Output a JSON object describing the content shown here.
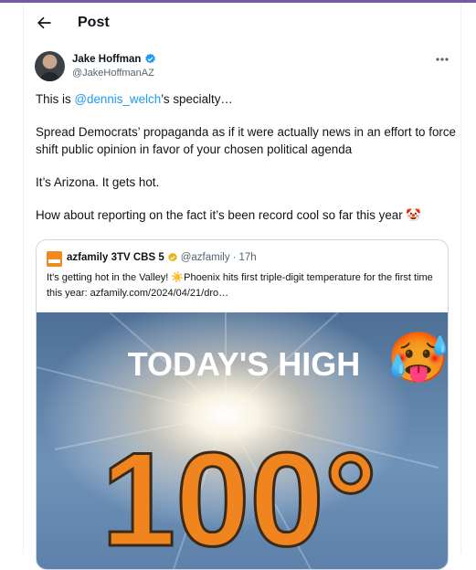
{
  "header": {
    "title": "Post",
    "back_icon": "back-arrow-icon"
  },
  "tweet": {
    "author_name": "Jake Hoffman",
    "author_handle": "@JakeHoffmanAZ",
    "verified_icon": "verified-badge-icon",
    "more_icon": "more-dots-icon",
    "line1_before": "This is ",
    "line1_mention": "@dennis_welch",
    "line1_after": "’s specialty…",
    "paragraph2": "Spread Democrats’ propaganda as if it were actually news in an effort to force shift public opinion in favor of your chosen political agenda",
    "paragraph3": "It’s Arizona. It gets hot.",
    "paragraph4": "How about reporting on the fact it’s been record cool so far this year 🤡"
  },
  "quote": {
    "name": "azfamily 3TV CBS 5",
    "handle": "@azfamily",
    "separator": "·",
    "time": "17h",
    "badge_icon": "gold-verified-badge-icon",
    "text": "It's getting hot in the Valley! ☀️Phoenix hits first triple-digit temperature for the first time this year: azfamily.com/2024/04/21/dro…",
    "image": {
      "headline": "TODAY'S HIGH",
      "temperature": "100°",
      "emoji": "🥵"
    }
  },
  "colors": {
    "accent": "#1d9bf0",
    "verified_gold": "#e2b719",
    "image_orange": "#f0841f",
    "top_border": "#7856a3"
  }
}
